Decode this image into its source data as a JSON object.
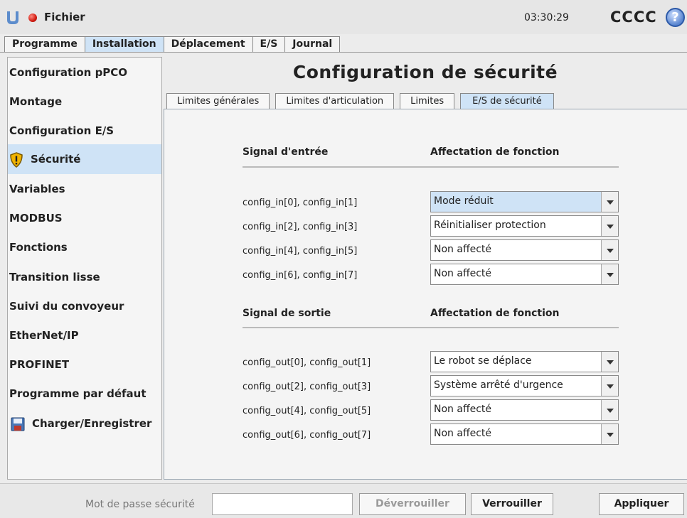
{
  "header": {
    "file_label": "Fichier",
    "clock": "03:30:29",
    "robot_name": "CCCC",
    "help_glyph": "?"
  },
  "main_tabs": [
    "Programme",
    "Installation",
    "Déplacement",
    "E/S",
    "Journal"
  ],
  "main_tab_active": "Installation",
  "sidebar": {
    "items": [
      "Configuration pPCO",
      "Montage",
      "Configuration E/S",
      "Sécurité",
      "Variables",
      "MODBUS",
      "Fonctions",
      "Transition lisse",
      "Suivi du convoyeur",
      "EtherNet/IP",
      "PROFINET",
      "Programme par défaut",
      "Charger/Enregistrer"
    ],
    "active": "Sécurité"
  },
  "page": {
    "title": "Configuration de sécurité",
    "subtabs": [
      "Limites générales",
      "Limites d'articulation",
      "Limites",
      "E/S de sécurité"
    ],
    "subtab_active": "E/S de sécurité"
  },
  "inputs_section": {
    "col_signal": "Signal d'entrée",
    "col_function": "Affectation de fonction",
    "rows": [
      {
        "signal": "config_in[0], config_in[1]",
        "value": "Mode réduit"
      },
      {
        "signal": "config_in[2], config_in[3]",
        "value": "Réinitialiser protection"
      },
      {
        "signal": "config_in[4], config_in[5]",
        "value": "Non affecté"
      },
      {
        "signal": "config_in[6], config_in[7]",
        "value": "Non affecté"
      }
    ]
  },
  "outputs_section": {
    "col_signal": "Signal de sortie",
    "col_function": "Affectation de fonction",
    "rows": [
      {
        "signal": "config_out[0], config_out[1]",
        "value": "Le robot se déplace"
      },
      {
        "signal": "config_out[2], config_out[3]",
        "value": "Système arrêté d'urgence"
      },
      {
        "signal": "config_out[4], config_out[5]",
        "value": "Non affecté"
      },
      {
        "signal": "config_out[6], config_out[7]",
        "value": "Non affecté"
      }
    ]
  },
  "footer": {
    "password_label": "Mot de passe sécurité",
    "password_value": "",
    "unlock_label": "Déverrouiller",
    "lock_label": "Verrouiller",
    "apply_label": "Appliquer"
  },
  "colors": {
    "active_tab": "#cfe3f6",
    "status_dot": "#d01a10",
    "warning_icon": "#f2b400",
    "save_icon": "#c0392b"
  }
}
